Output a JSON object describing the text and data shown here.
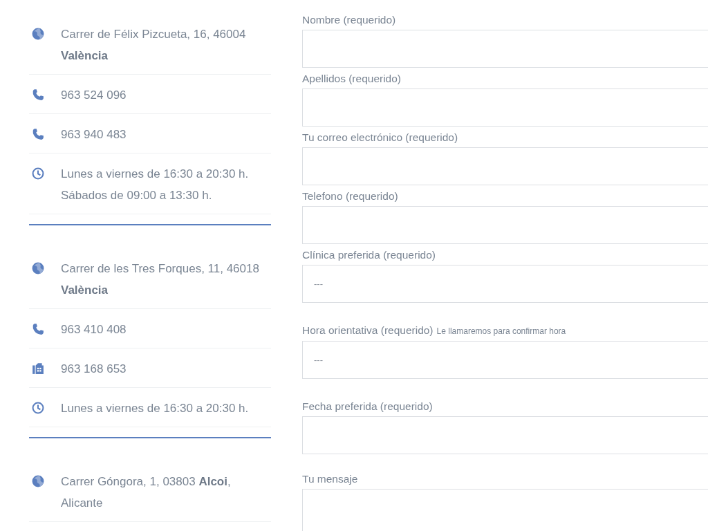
{
  "locations": [
    {
      "items": [
        {
          "kind": "address",
          "lines": [
            "Carrer de Félix Pizcueta, 16, 46004",
            "**València**"
          ]
        },
        {
          "kind": "phone",
          "lines": [
            "963 524 096"
          ]
        },
        {
          "kind": "phone",
          "lines": [
            "963 940 483"
          ]
        },
        {
          "kind": "hours",
          "lines": [
            "Lunes a viernes de 16:30 a 20:30 h.",
            "Sábados de 09:00 a 13:30 h."
          ]
        }
      ]
    },
    {
      "items": [
        {
          "kind": "address",
          "lines": [
            "Carrer de les Tres Forques, 11, 46018",
            "**València**"
          ]
        },
        {
          "kind": "phone",
          "lines": [
            "963 410 408"
          ]
        },
        {
          "kind": "fax",
          "lines": [
            "963 168 653"
          ]
        },
        {
          "kind": "hours",
          "lines": [
            "Lunes a viernes de 16:30 a 20:30 h."
          ]
        }
      ]
    },
    {
      "items": [
        {
          "kind": "address",
          "lines": [
            "Carrer Góngora, 1, 03803 **Alcoi**,",
            "Alicante"
          ]
        }
      ]
    }
  ],
  "form": {
    "fields": [
      {
        "kind": "text",
        "label": "Nombre (requerido)"
      },
      {
        "kind": "text",
        "label": "Apellidos (requerido)"
      },
      {
        "kind": "text",
        "label": "Tu correo electrónico (requerido)"
      },
      {
        "kind": "text",
        "label": "Telefono (requerido)"
      },
      {
        "kind": "select",
        "label": "Clínica preferida (requerido)",
        "value": "---"
      },
      {
        "kind": "select",
        "label": "Hora orientativa (requerido)",
        "hint": "Le llamaremos para confirmar hora",
        "value": "---"
      },
      {
        "kind": "date",
        "label": "Fecha preferida (requerido)"
      },
      {
        "kind": "textarea",
        "label": "Tu mensaje"
      }
    ]
  }
}
